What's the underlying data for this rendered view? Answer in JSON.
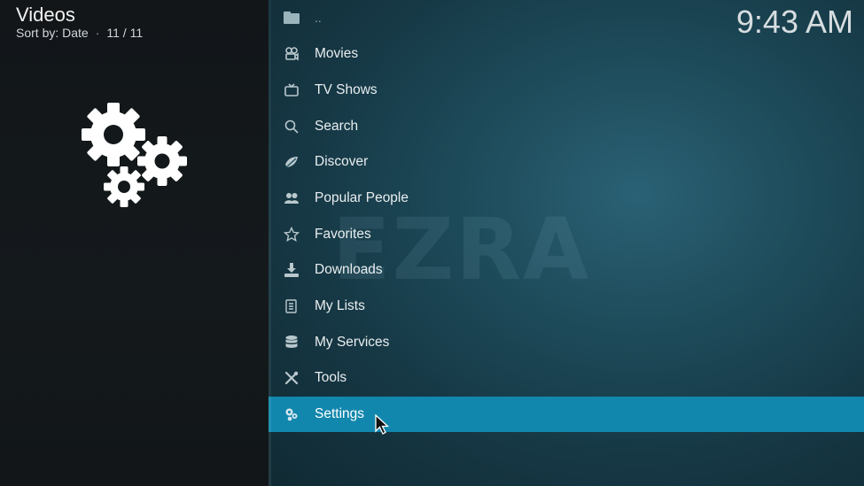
{
  "header": {
    "title": "Videos",
    "sort_label": "Sort by: Date",
    "position": "11 / 11"
  },
  "clock": "9:43 AM",
  "watermark": "EZRA",
  "menu": {
    "parent_label": "..",
    "items": [
      {
        "label": "Movies",
        "icon": "film-icon"
      },
      {
        "label": "TV Shows",
        "icon": "tv-icon"
      },
      {
        "label": "Search",
        "icon": "search-icon"
      },
      {
        "label": "Discover",
        "icon": "discover-icon"
      },
      {
        "label": "Popular People",
        "icon": "people-icon"
      },
      {
        "label": "Favorites",
        "icon": "star-icon"
      },
      {
        "label": "Downloads",
        "icon": "download-icon"
      },
      {
        "label": "My Lists",
        "icon": "list-icon"
      },
      {
        "label": "My Services",
        "icon": "database-icon"
      },
      {
        "label": "Tools",
        "icon": "tools-icon"
      },
      {
        "label": "Settings",
        "icon": "settings-icon",
        "selected": true
      }
    ]
  },
  "colors": {
    "selection": "#1287ad",
    "background": "#101417",
    "panel": "#1d4a59"
  }
}
